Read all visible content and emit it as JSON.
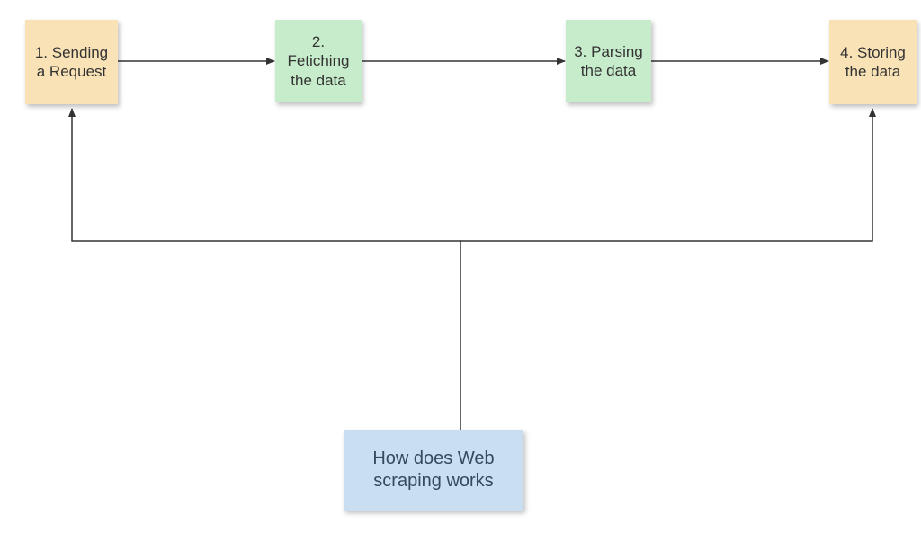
{
  "diagram": {
    "title_note": "How does Web scraping works",
    "steps": [
      {
        "id": 1,
        "label": "1. Sending a Request",
        "color": "yellow"
      },
      {
        "id": 2,
        "label": "2. Fetiching the data",
        "color": "green"
      },
      {
        "id": 3,
        "label": "3. Parsing the data",
        "color": "green"
      },
      {
        "id": 4,
        "label": "4. Storing the data",
        "color": "yellow"
      }
    ],
    "connections": [
      {
        "from": "step-1",
        "to": "step-2",
        "type": "arrow-right"
      },
      {
        "from": "step-2",
        "to": "step-3",
        "type": "arrow-right"
      },
      {
        "from": "step-3",
        "to": "step-4",
        "type": "arrow-right"
      },
      {
        "from": "title-note",
        "to": "step-1",
        "type": "polyline-up"
      },
      {
        "from": "title-note",
        "to": "step-4",
        "type": "polyline-up"
      }
    ],
    "colors": {
      "yellow": "#f9e3b6",
      "green": "#c7eccb",
      "blue": "#c9def0",
      "stroke": "#333333"
    }
  }
}
